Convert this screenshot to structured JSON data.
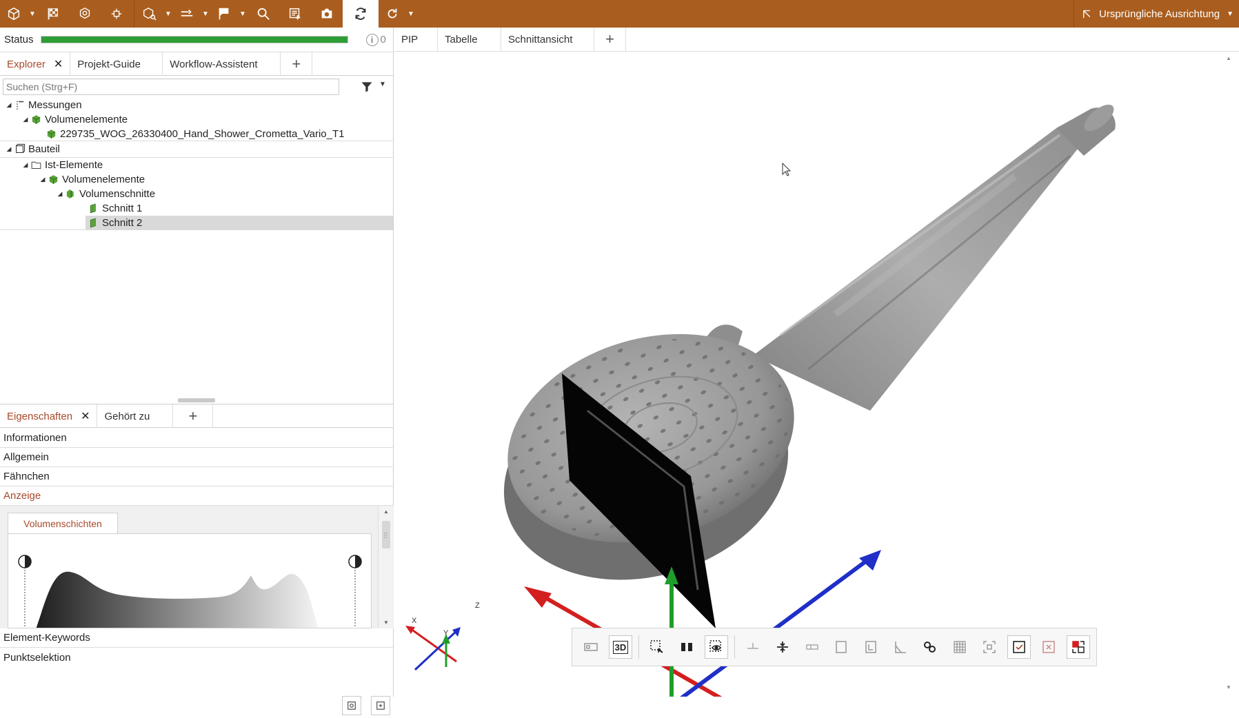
{
  "toolbar": {
    "orientation_label": "Ursprüngliche Ausrichtung"
  },
  "status": {
    "label": "Status",
    "progress": 1.0,
    "info_count": "0"
  },
  "explorer_tabs": {
    "items": [
      {
        "label": "Explorer"
      },
      {
        "label": "Projekt-Guide"
      },
      {
        "label": "Workflow-Assistent"
      }
    ],
    "add_label": "+",
    "close_label": "✕"
  },
  "search": {
    "placeholder": "Suchen (Strg+F)"
  },
  "tree": {
    "messungen": "Messungen",
    "volumenelemente_1": "Volumenelemente",
    "dataset": "229735_WOG_26330400_Hand_Shower_Crometta_Vario_T1",
    "bauteil": "Bauteil",
    "ist_elemente": "Ist-Elemente",
    "volumenelemente_2": "Volumenelemente",
    "volumenschnitte": "Volumenschnitte",
    "schnitt1": "Schnitt 1",
    "schnitt2": "Schnitt 2"
  },
  "prop_tabs": {
    "items": [
      {
        "label": "Eigenschaften"
      },
      {
        "label": "Gehört zu"
      }
    ],
    "add_label": "+",
    "close_label": "✕"
  },
  "properties": {
    "informationen": "Informationen",
    "allgemein": "Allgemein",
    "faehnchen": "Fähnchen",
    "anzeige": "Anzeige",
    "volumenschichten": "Volumenschichten",
    "element_keywords": "Element-Keywords",
    "punktselektion": "Punktselektion"
  },
  "view_tabs": {
    "items": [
      {
        "label": "PIP"
      },
      {
        "label": "Tabelle"
      },
      {
        "label": "Schnittansicht"
      }
    ],
    "add_label": "+"
  },
  "view_tools": {
    "three_d_label": "3D"
  },
  "axis_labels": {
    "x": "X",
    "y": "Y",
    "z": "Z"
  },
  "colors": {
    "toolbar": "#a95e1f",
    "accent": "#a8482a",
    "progress": "#2e9d36",
    "axis_x": "#d31f1f",
    "axis_y": "#1f9d2b",
    "axis_z": "#1f2fc8"
  }
}
